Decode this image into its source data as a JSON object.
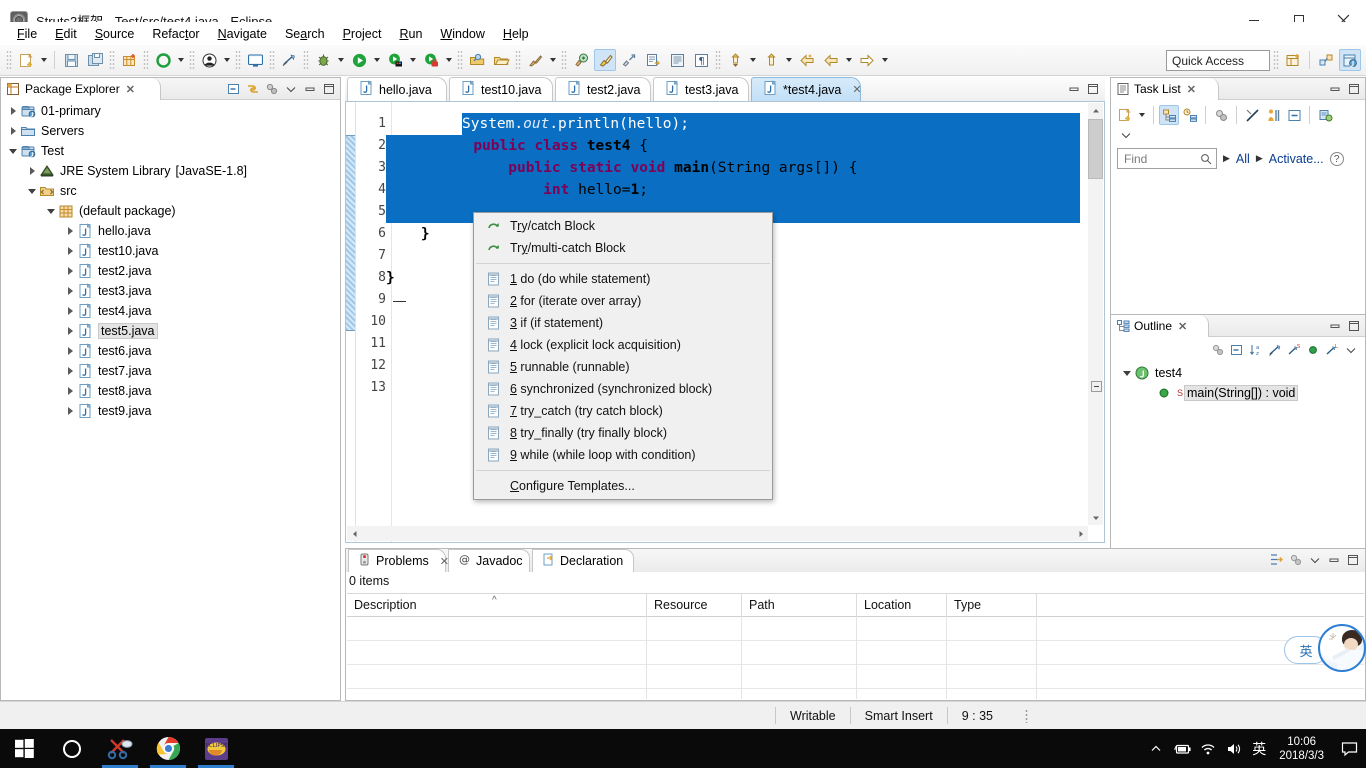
{
  "window": {
    "title": "Struts2框架 - Test/src/test4.java - Eclipse",
    "app_icon": "eclipse-icon",
    "minimize": "minimize-button",
    "maximize": "maximize-button",
    "close": "close-button"
  },
  "menubar": {
    "items": [
      "File",
      "Edit",
      "Source",
      "Refactor",
      "Navigate",
      "Search",
      "Project",
      "Run",
      "Window",
      "Help"
    ]
  },
  "toolbar": {
    "quick_access_placeholder": "Quick Access",
    "buttons": [
      "new-button",
      "new-dropdown",
      "save-button",
      "save-all-button",
      "new-java-package-button",
      "build-button",
      "build-dropdown",
      "skip-breakpoints-button",
      "skip-dropdown",
      "open-console-button",
      "toggle-breakpoint-button",
      "debug-button",
      "debug-dropdown",
      "run-button",
      "run-dropdown",
      "run-as-button",
      "run-as-dropdown",
      "coverage-button",
      "coverage-dropdown",
      "open-type-button",
      "open-task-button",
      "search-button",
      "search-dropdown",
      "new-annotation-button",
      "mark-occurrences-button",
      "link-button",
      "next-edit-button",
      "previous-edit-button",
      "show-whitespace-button",
      "next-annotation-button",
      "next-annotation-dropdown",
      "previous-annotation-button",
      "previous-annotation-dropdown",
      "back-button",
      "forward-button",
      "forward-dropdown",
      "history-dropdown"
    ],
    "perspective": [
      "open-perspective-button",
      "java-ee-perspective",
      "java-perspective"
    ]
  },
  "package_explorer": {
    "title": "Package Explorer",
    "close": "close-icon",
    "tools": [
      "collapse-all-icon",
      "link-with-editor-icon",
      "view-menu-icon",
      "minimize-icon",
      "maximize-icon"
    ],
    "tree": [
      {
        "label": "01-primary",
        "icon": "java-project-icon",
        "indent": 0,
        "state": "collapsed",
        "selected": false
      },
      {
        "label": "Servers",
        "icon": "folder-icon",
        "indent": 0,
        "state": "collapsed",
        "selected": false
      },
      {
        "label": "Test",
        "icon": "java-project-icon",
        "indent": 0,
        "state": "expanded",
        "selected": false
      },
      {
        "label": "JRE System Library",
        "suffix": "[JavaSE-1.8]",
        "icon": "library-icon",
        "indent": 1,
        "state": "collapsed",
        "selected": false
      },
      {
        "label": "src",
        "icon": "source-folder-icon",
        "indent": 1,
        "state": "expanded",
        "selected": false
      },
      {
        "label": "(default package)",
        "icon": "package-icon",
        "indent": 2,
        "state": "expanded",
        "selected": false
      },
      {
        "label": "hello.java",
        "icon": "java-file-icon",
        "indent": 3,
        "state": "collapsed",
        "selected": false
      },
      {
        "label": "test10.java",
        "icon": "java-file-icon",
        "indent": 3,
        "state": "collapsed",
        "selected": false
      },
      {
        "label": "test2.java",
        "icon": "java-file-icon",
        "indent": 3,
        "state": "collapsed",
        "selected": false
      },
      {
        "label": "test3.java",
        "icon": "java-file-icon",
        "indent": 3,
        "state": "collapsed",
        "selected": false
      },
      {
        "label": "test4.java",
        "icon": "java-file-icon",
        "indent": 3,
        "state": "collapsed",
        "selected": false
      },
      {
        "label": "test5.java",
        "icon": "java-file-icon",
        "indent": 3,
        "state": "collapsed",
        "selected": true
      },
      {
        "label": "test6.java",
        "icon": "java-file-icon",
        "indent": 3,
        "state": "collapsed",
        "selected": false
      },
      {
        "label": "test7.java",
        "icon": "java-file-icon",
        "indent": 3,
        "state": "collapsed",
        "selected": false
      },
      {
        "label": "test8.java",
        "icon": "java-file-icon",
        "indent": 3,
        "state": "collapsed",
        "selected": false
      },
      {
        "label": "test9.java",
        "icon": "java-file-icon",
        "indent": 3,
        "state": "collapsed",
        "selected": false
      }
    ]
  },
  "editor": {
    "tabs": [
      {
        "label": "hello.java",
        "active": false,
        "dirty": false
      },
      {
        "label": "test10.java",
        "active": false,
        "dirty": false
      },
      {
        "label": "test2.java",
        "active": false,
        "dirty": false
      },
      {
        "label": "test3.java",
        "active": false,
        "dirty": false
      },
      {
        "label": "*test4.java",
        "active": true,
        "dirty": true
      }
    ],
    "tab_tools": [
      "minimize-icon",
      "maximize-icon"
    ],
    "line_numbers": [
      "1",
      "2",
      "3",
      "4",
      "5",
      "6",
      "7",
      "8",
      "9",
      "10",
      "11",
      "12",
      "13"
    ],
    "code_lines": [
      {
        "n": 1,
        "text": ""
      },
      {
        "n": 2,
        "text": "public class test4 {"
      },
      {
        "n": 3,
        "text": "    public static void main(String args[]) {"
      },
      {
        "n": 4,
        "text": "        int hello=1;"
      },
      {
        "n": 5,
        "text": "        System.out.println(hello);"
      },
      {
        "n": 6,
        "text": ""
      },
      {
        "n": 7,
        "text": ""
      },
      {
        "n": 8,
        "text": ""
      },
      {
        "n": 9,
        "text": ""
      },
      {
        "n": 10,
        "text": "    }"
      },
      {
        "n": 11,
        "text": ""
      },
      {
        "n": 12,
        "text": "}"
      },
      {
        "n": 13,
        "text": ""
      }
    ],
    "selection_start_line": 5,
    "selection_end_line": 9
  },
  "context_menu": {
    "items": [
      {
        "label": "Try/catch Block",
        "icon": "quickfix-icon",
        "mnemonic_index": 1,
        "group": 0
      },
      {
        "label": "Try/multi-catch Block",
        "icon": "quickfix-icon",
        "mnemonic_index": 2,
        "group": 0
      },
      {
        "label": "1 do (do while statement)",
        "icon": "template-icon",
        "mnemonic_index": 0,
        "group": 1
      },
      {
        "label": "2 for (iterate over array)",
        "icon": "template-icon",
        "mnemonic_index": 0,
        "group": 1
      },
      {
        "label": "3 if (if statement)",
        "icon": "template-icon",
        "mnemonic_index": 0,
        "group": 1
      },
      {
        "label": "4 lock (explicit lock acquisition)",
        "icon": "template-icon",
        "mnemonic_index": 0,
        "group": 1
      },
      {
        "label": "5 runnable (runnable)",
        "icon": "template-icon",
        "mnemonic_index": 0,
        "group": 1
      },
      {
        "label": "6 synchronized (synchronized block)",
        "icon": "template-icon",
        "mnemonic_index": 0,
        "group": 1
      },
      {
        "label": "7 try_catch (try catch block)",
        "icon": "template-icon",
        "mnemonic_index": 0,
        "group": 1
      },
      {
        "label": "8 try_finally (try finally block)",
        "icon": "template-icon",
        "mnemonic_index": 0,
        "group": 1
      },
      {
        "label": "9 while (while loop with condition)",
        "icon": "template-icon",
        "mnemonic_index": 0,
        "group": 1
      },
      {
        "label": "Configure Templates...",
        "icon": "",
        "mnemonic_index": 0,
        "group": 2
      }
    ]
  },
  "task_list": {
    "title": "Task List",
    "tools": [
      "new-task-icon",
      "new-task-dropdown",
      "categorized-icon",
      "scheduled-icon",
      "focus-icon",
      "synchronize-icon",
      "presentation-icon",
      "collapse-icon",
      "view-menu-icon",
      "chevron-down-icon"
    ],
    "find_placeholder": "Find",
    "filter_all": "All",
    "filter_activate": "Activate...",
    "help": "help-icon"
  },
  "outline": {
    "title": "Outline",
    "tools": [
      "focus-icon",
      "collapse-all-icon",
      "sort-icon",
      "hide-fields-icon",
      "hide-static-icon",
      "hide-nonpublic-icon",
      "hide-local-icon",
      "view-menu-icon"
    ],
    "tree": [
      {
        "label": "test4",
        "icon": "class-icon",
        "indent": 0,
        "state": "expanded",
        "selected": false
      },
      {
        "label": "main(String[]) : void",
        "icon": "method-public-static-icon",
        "indent": 1,
        "state": "leaf",
        "selected": true
      }
    ]
  },
  "problems": {
    "tabs": [
      {
        "label": "Problems",
        "icon": "problems-icon",
        "active": true
      },
      {
        "label": "Javadoc",
        "icon": "javadoc-icon",
        "active": false
      },
      {
        "label": "Declaration",
        "icon": "declaration-icon",
        "active": false
      }
    ],
    "item_count": "0 items",
    "columns": [
      "Description",
      "Resource",
      "Path",
      "Location",
      "Type"
    ],
    "sort_indicator_column": "Description",
    "rows": [],
    "tools": [
      "focus-on-selection-icon",
      "view-menu-icon",
      "minimize-icon",
      "maximize-icon"
    ]
  },
  "statusbar": {
    "writable": "Writable",
    "insert_mode": "Smart Insert",
    "caret_position": "9 : 35"
  },
  "taskbar": {
    "start": "windows-start-icon",
    "items": [
      "cortana-search-icon",
      "snipping-tool-icon",
      "chrome-icon",
      "eclipse-icon"
    ],
    "tray": [
      "chevron-up-icon",
      "battery-icon",
      "wifi-icon",
      "volume-icon"
    ],
    "ime_label": "英",
    "clock_time": "10:06",
    "clock_date": "2018/3/3",
    "action_center": "notification-icon"
  },
  "ime_floater": {
    "mode": "英",
    "avatar": "sogou-avatar-icon"
  },
  "colors": {
    "selection_blue": "#0a6fc2",
    "keyword_purple": "#7f0055",
    "static_field_blue": "#0000c0",
    "active_tab_blue": "#c2e0f7",
    "link_blue": "#0a3d91"
  }
}
